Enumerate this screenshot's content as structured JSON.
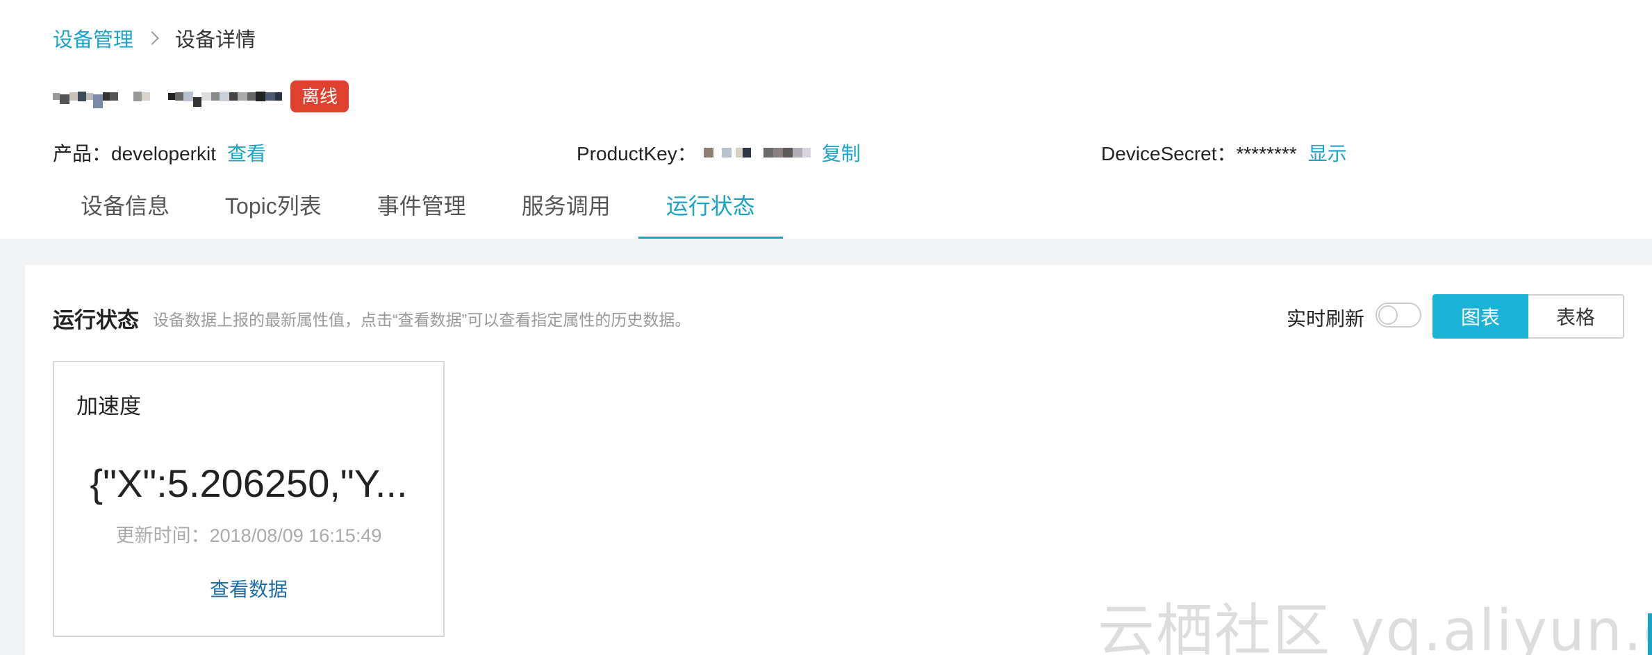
{
  "breadcrumb": {
    "parent": "设备管理",
    "current": "设备详情"
  },
  "device": {
    "status": "离线",
    "status_color": "#e0412f"
  },
  "meta": {
    "product_label": "产品：developerkit",
    "product_link": "查看",
    "productkey_label": "ProductKey：",
    "productkey_link": "复制",
    "devicesecret_label": "DeviceSecret：********",
    "devicesecret_link": "显示"
  },
  "tabs": [
    {
      "label": "设备信息"
    },
    {
      "label": "Topic列表"
    },
    {
      "label": "事件管理"
    },
    {
      "label": "服务调用"
    },
    {
      "label": "运行状态",
      "active": true
    }
  ],
  "panel": {
    "title": "运行状态",
    "description": "设备数据上报的最新属性值，点击“查看数据”可以查看指定属性的历史数据。",
    "refresh_label": "实时刷新",
    "refresh_on": false,
    "view_chart": "图表",
    "view_table": "表格"
  },
  "card": {
    "title": "加速度",
    "value": "{\"X\":5.206250,\"Y...",
    "updated": "更新时间：2018/08/09 16:15:49",
    "link": "查看数据"
  },
  "watermark": "云栖社区 yq.aliyun.com",
  "colors": {
    "accent": "#1aa3c6",
    "active_button": "#1ab2d6",
    "link_dark": "#1d6ea8"
  }
}
